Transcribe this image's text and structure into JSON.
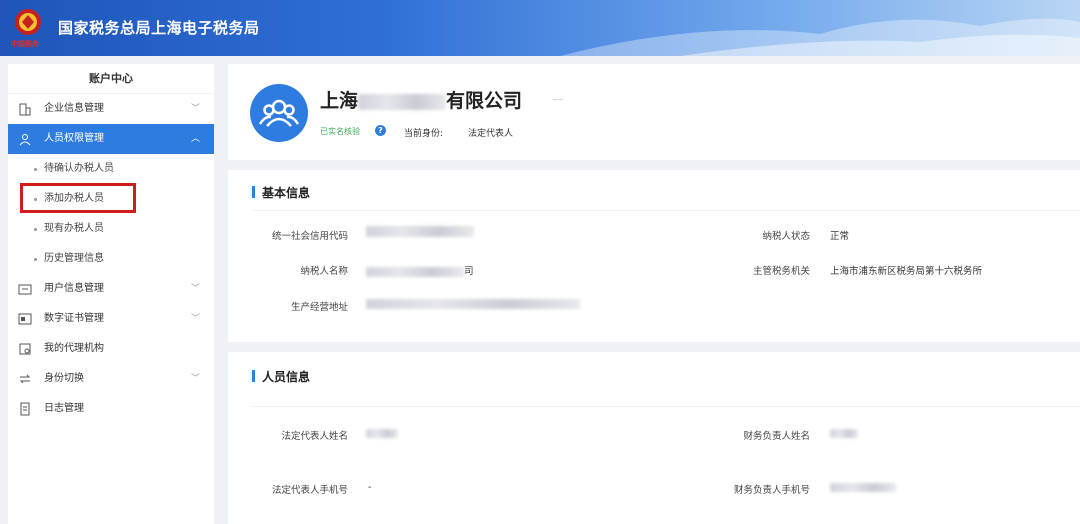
{
  "header": {
    "title": "国家税务总局上海电子税务局",
    "emblem_text": "中国税务"
  },
  "sidebar": {
    "title": "账户中心",
    "items": [
      {
        "label": "企业信息管理",
        "icon": "building-icon",
        "expandable": true,
        "expanded": false
      },
      {
        "label": "人员权限管理",
        "icon": "people-icon",
        "expandable": true,
        "expanded": true,
        "active": true
      },
      {
        "label": "用户信息管理",
        "icon": "id-card-icon",
        "expandable": true,
        "expanded": false
      },
      {
        "label": "数字证书管理",
        "icon": "certificate-icon",
        "expandable": true,
        "expanded": false
      },
      {
        "label": "我的代理机构",
        "icon": "agency-icon",
        "expandable": false
      },
      {
        "label": "身份切换",
        "icon": "switch-icon",
        "expandable": true,
        "expanded": false
      },
      {
        "label": "日志管理",
        "icon": "log-icon",
        "expandable": false
      }
    ],
    "subitems": [
      {
        "label": "待确认办税人员"
      },
      {
        "label": "添加办税人员",
        "highlighted": true
      },
      {
        "label": "现有办税人员"
      },
      {
        "label": "历史管理信息"
      }
    ],
    "accent_color": "#2f7ce0",
    "highlight_color": "#d11c1c"
  },
  "profile": {
    "company_prefix": "上海",
    "company_suffix": "有限公司",
    "verified": "已实名核验",
    "identity_label": "当前身份:",
    "identity_value": "法定代表人"
  },
  "basic_info": {
    "title": "基本信息",
    "fields": {
      "credit_code_label": "统一社会信用代码",
      "taxpayer_name_label": "纳税人名称",
      "taxpayer_name_tail": "司",
      "address_label": "生产经营地址",
      "status_label": "纳税人状态",
      "status_value": "正常",
      "tax_office_label": "主管税务机关",
      "tax_office_value": "上海市浦东新区税务局第十六税务所"
    }
  },
  "person_info": {
    "title": "人员信息",
    "fields": {
      "legal_rep_name_label": "法定代表人姓名",
      "finance_name_label": "财务负责人姓名",
      "legal_rep_phone_label": "法定代表人手机号",
      "legal_rep_phone_value": "-",
      "finance_phone_label": "财务负责人手机号"
    }
  }
}
